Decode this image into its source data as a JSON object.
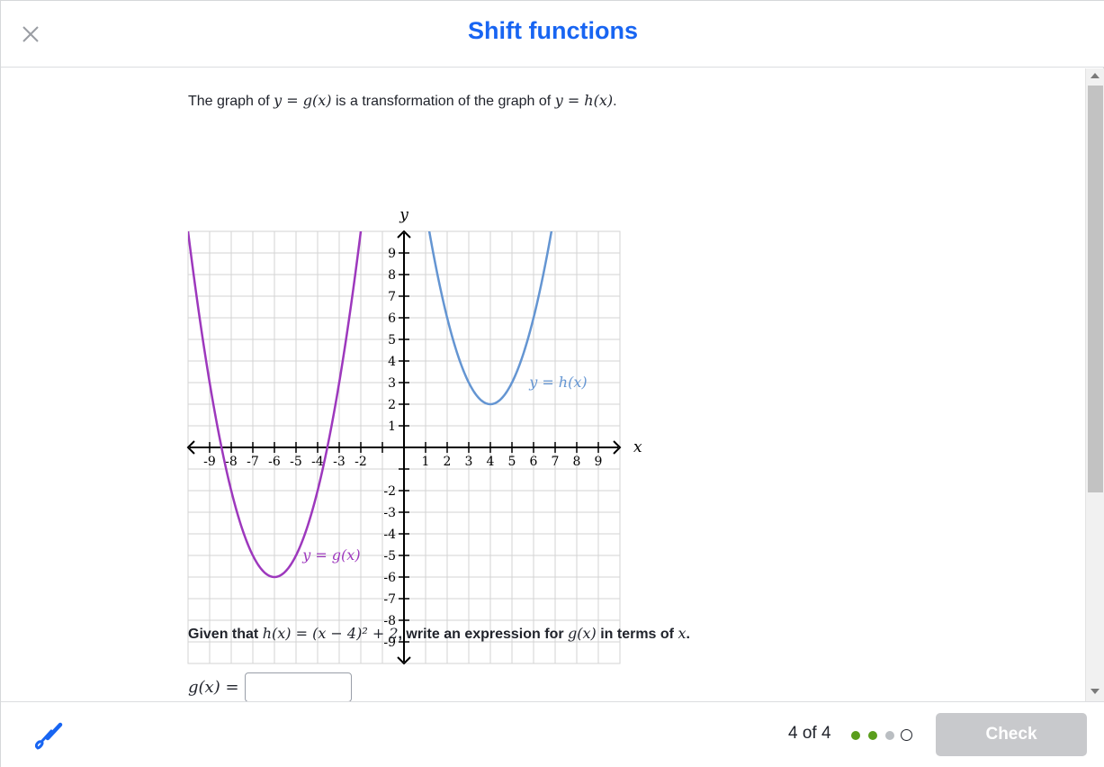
{
  "header": {
    "title": "Shift functions",
    "close_icon": "close-icon"
  },
  "problem": {
    "intro_prefix": "The graph of ",
    "intro_eq1": "y = g(x)",
    "intro_mid": " is a transformation of the graph of ",
    "intro_eq2": "y = h(x)",
    "intro_suffix": ".",
    "question_prefix": "Given that ",
    "question_eq": "h(x) = (x − 4)² + 2",
    "question_mid": ", write an expression for ",
    "question_g": "g(x)",
    "question_mid2": " in terms of ",
    "question_x": "x",
    "question_suffix": ".",
    "answer_label": "g(x) =",
    "answer_value": ""
  },
  "graph": {
    "x_axis_label": "x",
    "y_axis_label": "y",
    "x_ticks": [
      "-9",
      "-8",
      "-7",
      "-6",
      "-5",
      "-4",
      "-3",
      "-2",
      "1",
      "2",
      "3",
      "4",
      "5",
      "6",
      "7",
      "8",
      "9"
    ],
    "y_ticks": [
      "9",
      "8",
      "7",
      "6",
      "5",
      "4",
      "3",
      "2",
      "1",
      "-2",
      "-3",
      "-4",
      "-5",
      "-6",
      "-7",
      "-8",
      "-9"
    ],
    "x_range": [
      -10,
      10
    ],
    "y_range": [
      -10,
      10
    ],
    "curves": [
      {
        "label": "y = h(x)",
        "vertex": [
          4,
          2
        ],
        "color": "#6495d2"
      },
      {
        "label": "y = g(x)",
        "vertex": [
          -6,
          -6
        ],
        "color": "#9d38bd"
      }
    ]
  },
  "footer": {
    "progress": "4 of 4",
    "dots": [
      {
        "state": "correct",
        "color": "#5a9e1c"
      },
      {
        "state": "correct",
        "color": "#5a9e1c"
      },
      {
        "state": "skipped",
        "color": "#babec2"
      },
      {
        "state": "current",
        "color": "#21242c"
      }
    ],
    "check_label": "Check",
    "check_color": "#c8c9cc",
    "accent_color": "#1865f2",
    "scratchpad_icon": "pencil-icon"
  }
}
